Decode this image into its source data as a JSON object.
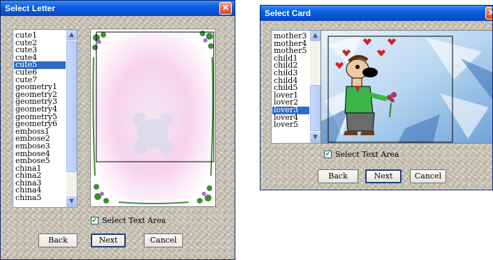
{
  "letter_dialog": {
    "title": "Select Letter",
    "close_label": "×",
    "items": [
      "cute1",
      "cute2",
      "cute3",
      "cute4",
      "cute5",
      "cute6",
      "cute7",
      "geometry1",
      "geometry2",
      "geometry3",
      "geometry4",
      "geometry5",
      "geometry6",
      "emboss1",
      "embose2",
      "embose3",
      "embose4",
      "embose5",
      "china1",
      "china2",
      "china3",
      "china4",
      "china5"
    ],
    "selected_index": 4,
    "checkbox_label": "Select Text Area",
    "checkbox_checked": true,
    "back_label": "Back",
    "next_label": "Next",
    "cancel_label": "Cancel"
  },
  "card_dialog": {
    "title": "Select Card",
    "close_label": "×",
    "items": [
      "mother3",
      "mother4",
      "mother5",
      "child1",
      "child2",
      "child3",
      "child4",
      "child5",
      "lover1",
      "lover2",
      "lover3",
      "lover4",
      "lover5"
    ],
    "selected_index": 10,
    "checkbox_label": "Select Text Area",
    "checkbox_checked": true,
    "back_label": "Back",
    "next_label": "Next",
    "cancel_label": "Cancel"
  },
  "icons": {
    "checkmark": "✔",
    "scroll_up": "▲",
    "scroll_down": "▼"
  },
  "colors": {
    "titlebar": "#0a5fe0",
    "selection": "#316ac5",
    "close_button": "#d9441a"
  }
}
